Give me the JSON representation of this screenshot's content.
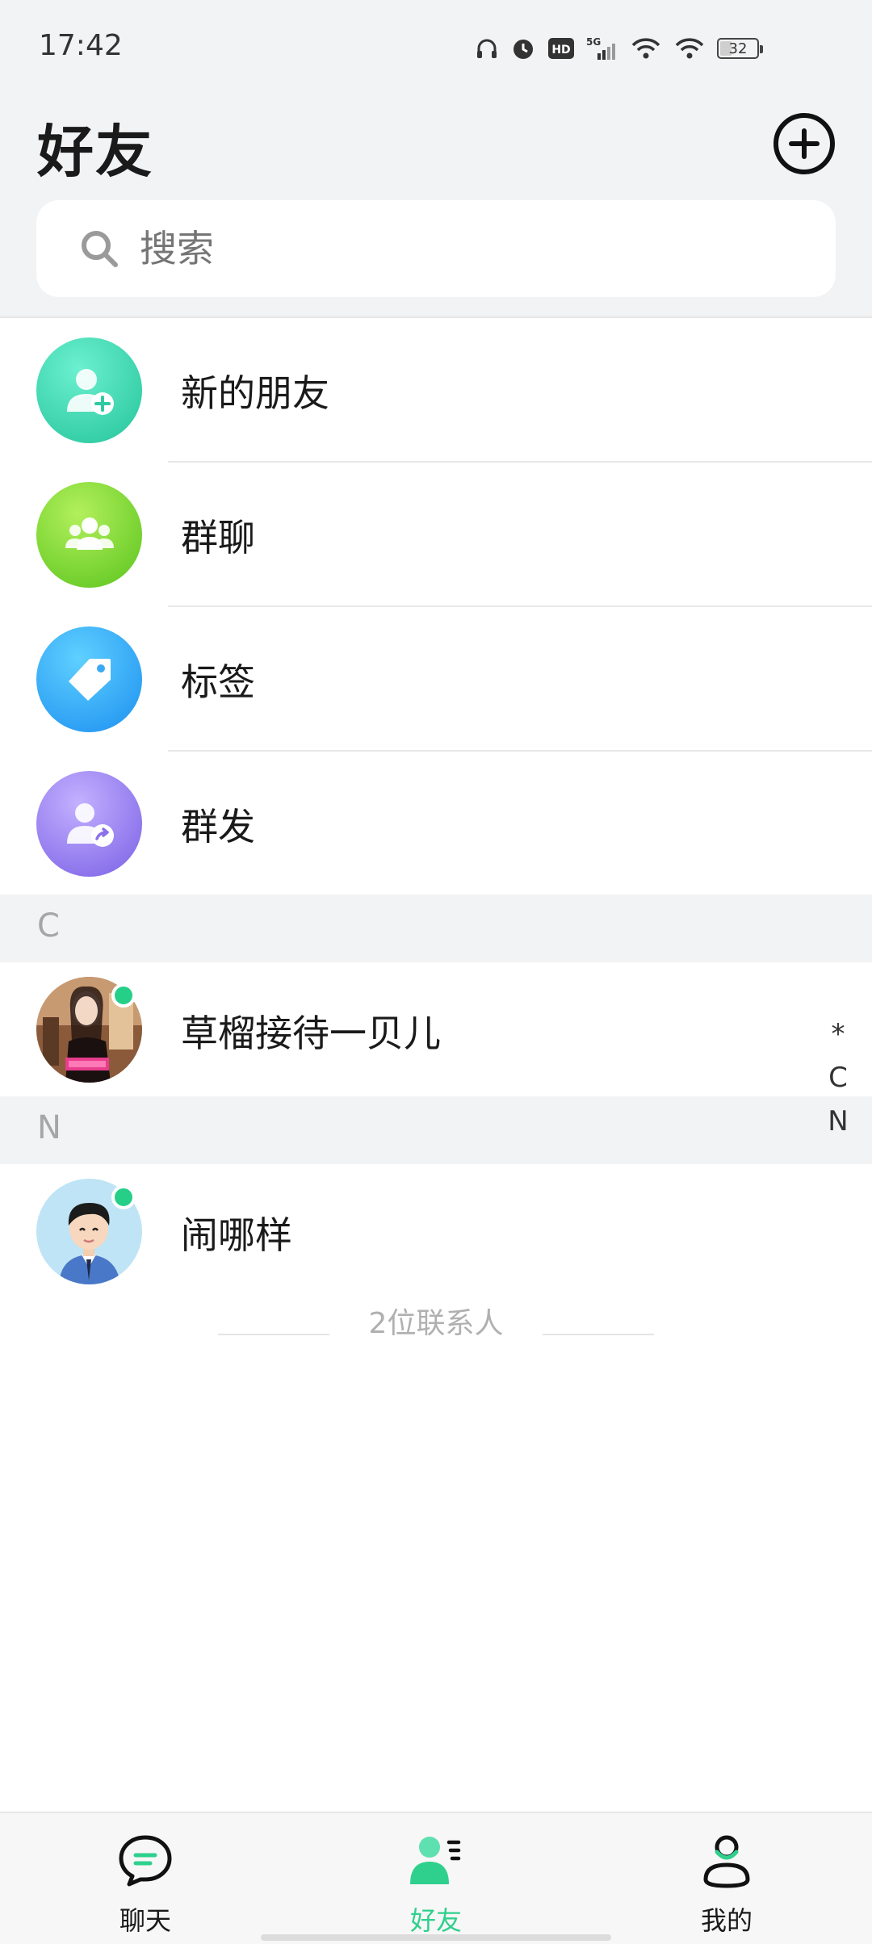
{
  "status_bar": {
    "time": "17:42",
    "battery": "32",
    "network": "5G",
    "hd": "HD"
  },
  "header": {
    "title": "好友"
  },
  "search": {
    "placeholder": "搜索"
  },
  "menu": [
    {
      "label": "新的朋友",
      "icon": "add-friend-icon",
      "color_top": "#5ce8c6",
      "color_bottom": "#27c9a0"
    },
    {
      "label": "群聊",
      "icon": "group-icon",
      "color_top": "#a6ea4e",
      "color_bottom": "#5dc91f"
    },
    {
      "label": "标签",
      "icon": "tag-icon",
      "color_top": "#52c7ff",
      "color_bottom": "#1f93f0"
    },
    {
      "label": "群发",
      "icon": "broadcast-icon",
      "color_top": "#b8a3ff",
      "color_bottom": "#7d62e8"
    }
  ],
  "sections": [
    {
      "letter": "C",
      "contacts": [
        {
          "name": "草榴接待一贝儿",
          "online": true
        }
      ]
    },
    {
      "letter": "N",
      "contacts": [
        {
          "name": "闹哪样",
          "online": true
        }
      ]
    }
  ],
  "index_bar": [
    "*",
    "C",
    "N"
  ],
  "contact_count": "2位联系人",
  "tabs": [
    {
      "label": "聊天",
      "icon": "chat-icon",
      "active": false
    },
    {
      "label": "好友",
      "icon": "contacts-icon",
      "active": true
    },
    {
      "label": "我的",
      "icon": "profile-icon",
      "active": false
    }
  ],
  "colors": {
    "accent": "#2fd08d",
    "online": "#25cf87",
    "background": "#f2f3f5"
  }
}
